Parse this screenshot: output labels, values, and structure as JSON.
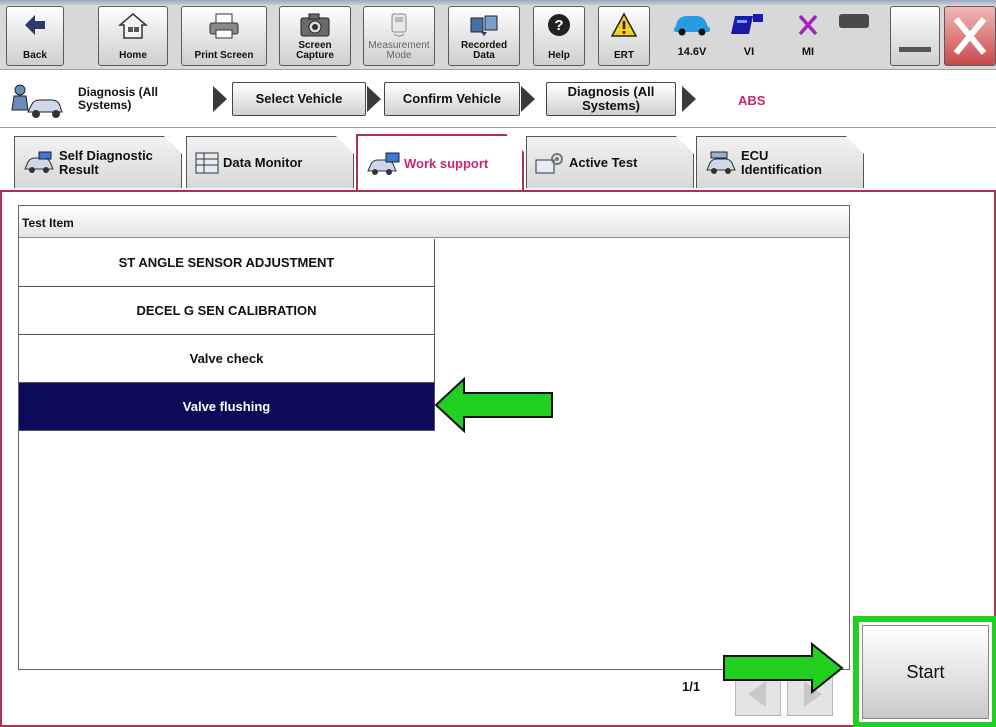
{
  "toolbar": {
    "back": "Back",
    "home": "Home",
    "print_screen": "Print Screen",
    "screen_capture": "Screen\nCapture",
    "measurement_mode": "Measurement\nMode",
    "recorded_data": "Recorded\nData",
    "help": "Help",
    "ert": "ERT",
    "battery_voltage": "14.6V",
    "vi": "VI",
    "mi": "MI"
  },
  "breadcrumb": {
    "current_label": "Diagnosis (All\nSystems)",
    "steps": [
      "Select Vehicle",
      "Confirm Vehicle",
      "Diagnosis (All\nSystems)"
    ],
    "system": "ABS"
  },
  "tabs": [
    {
      "label": "Self Diagnostic\nResult",
      "active": false
    },
    {
      "label": "Data Monitor",
      "active": false
    },
    {
      "label": "Work support",
      "active": true
    },
    {
      "label": "Active Test",
      "active": false
    },
    {
      "label": "ECU\nIdentification",
      "active": false
    }
  ],
  "list": {
    "header": "Test Item",
    "items": [
      {
        "label": "ST ANGLE SENSOR ADJUSTMENT",
        "selected": false
      },
      {
        "label": "DECEL G SEN CALIBRATION",
        "selected": false
      },
      {
        "label": "Valve check",
        "selected": false
      },
      {
        "label": "Valve flushing",
        "selected": true
      }
    ],
    "page_indicator": "1/1"
  },
  "start_label": "Start",
  "colors": {
    "selected_row": "#0b0b5a",
    "highlight_green": "#22d022",
    "active_tab_text": "#c8286e",
    "active_tab_border": "#b03050",
    "system_text": "#c8286e"
  }
}
